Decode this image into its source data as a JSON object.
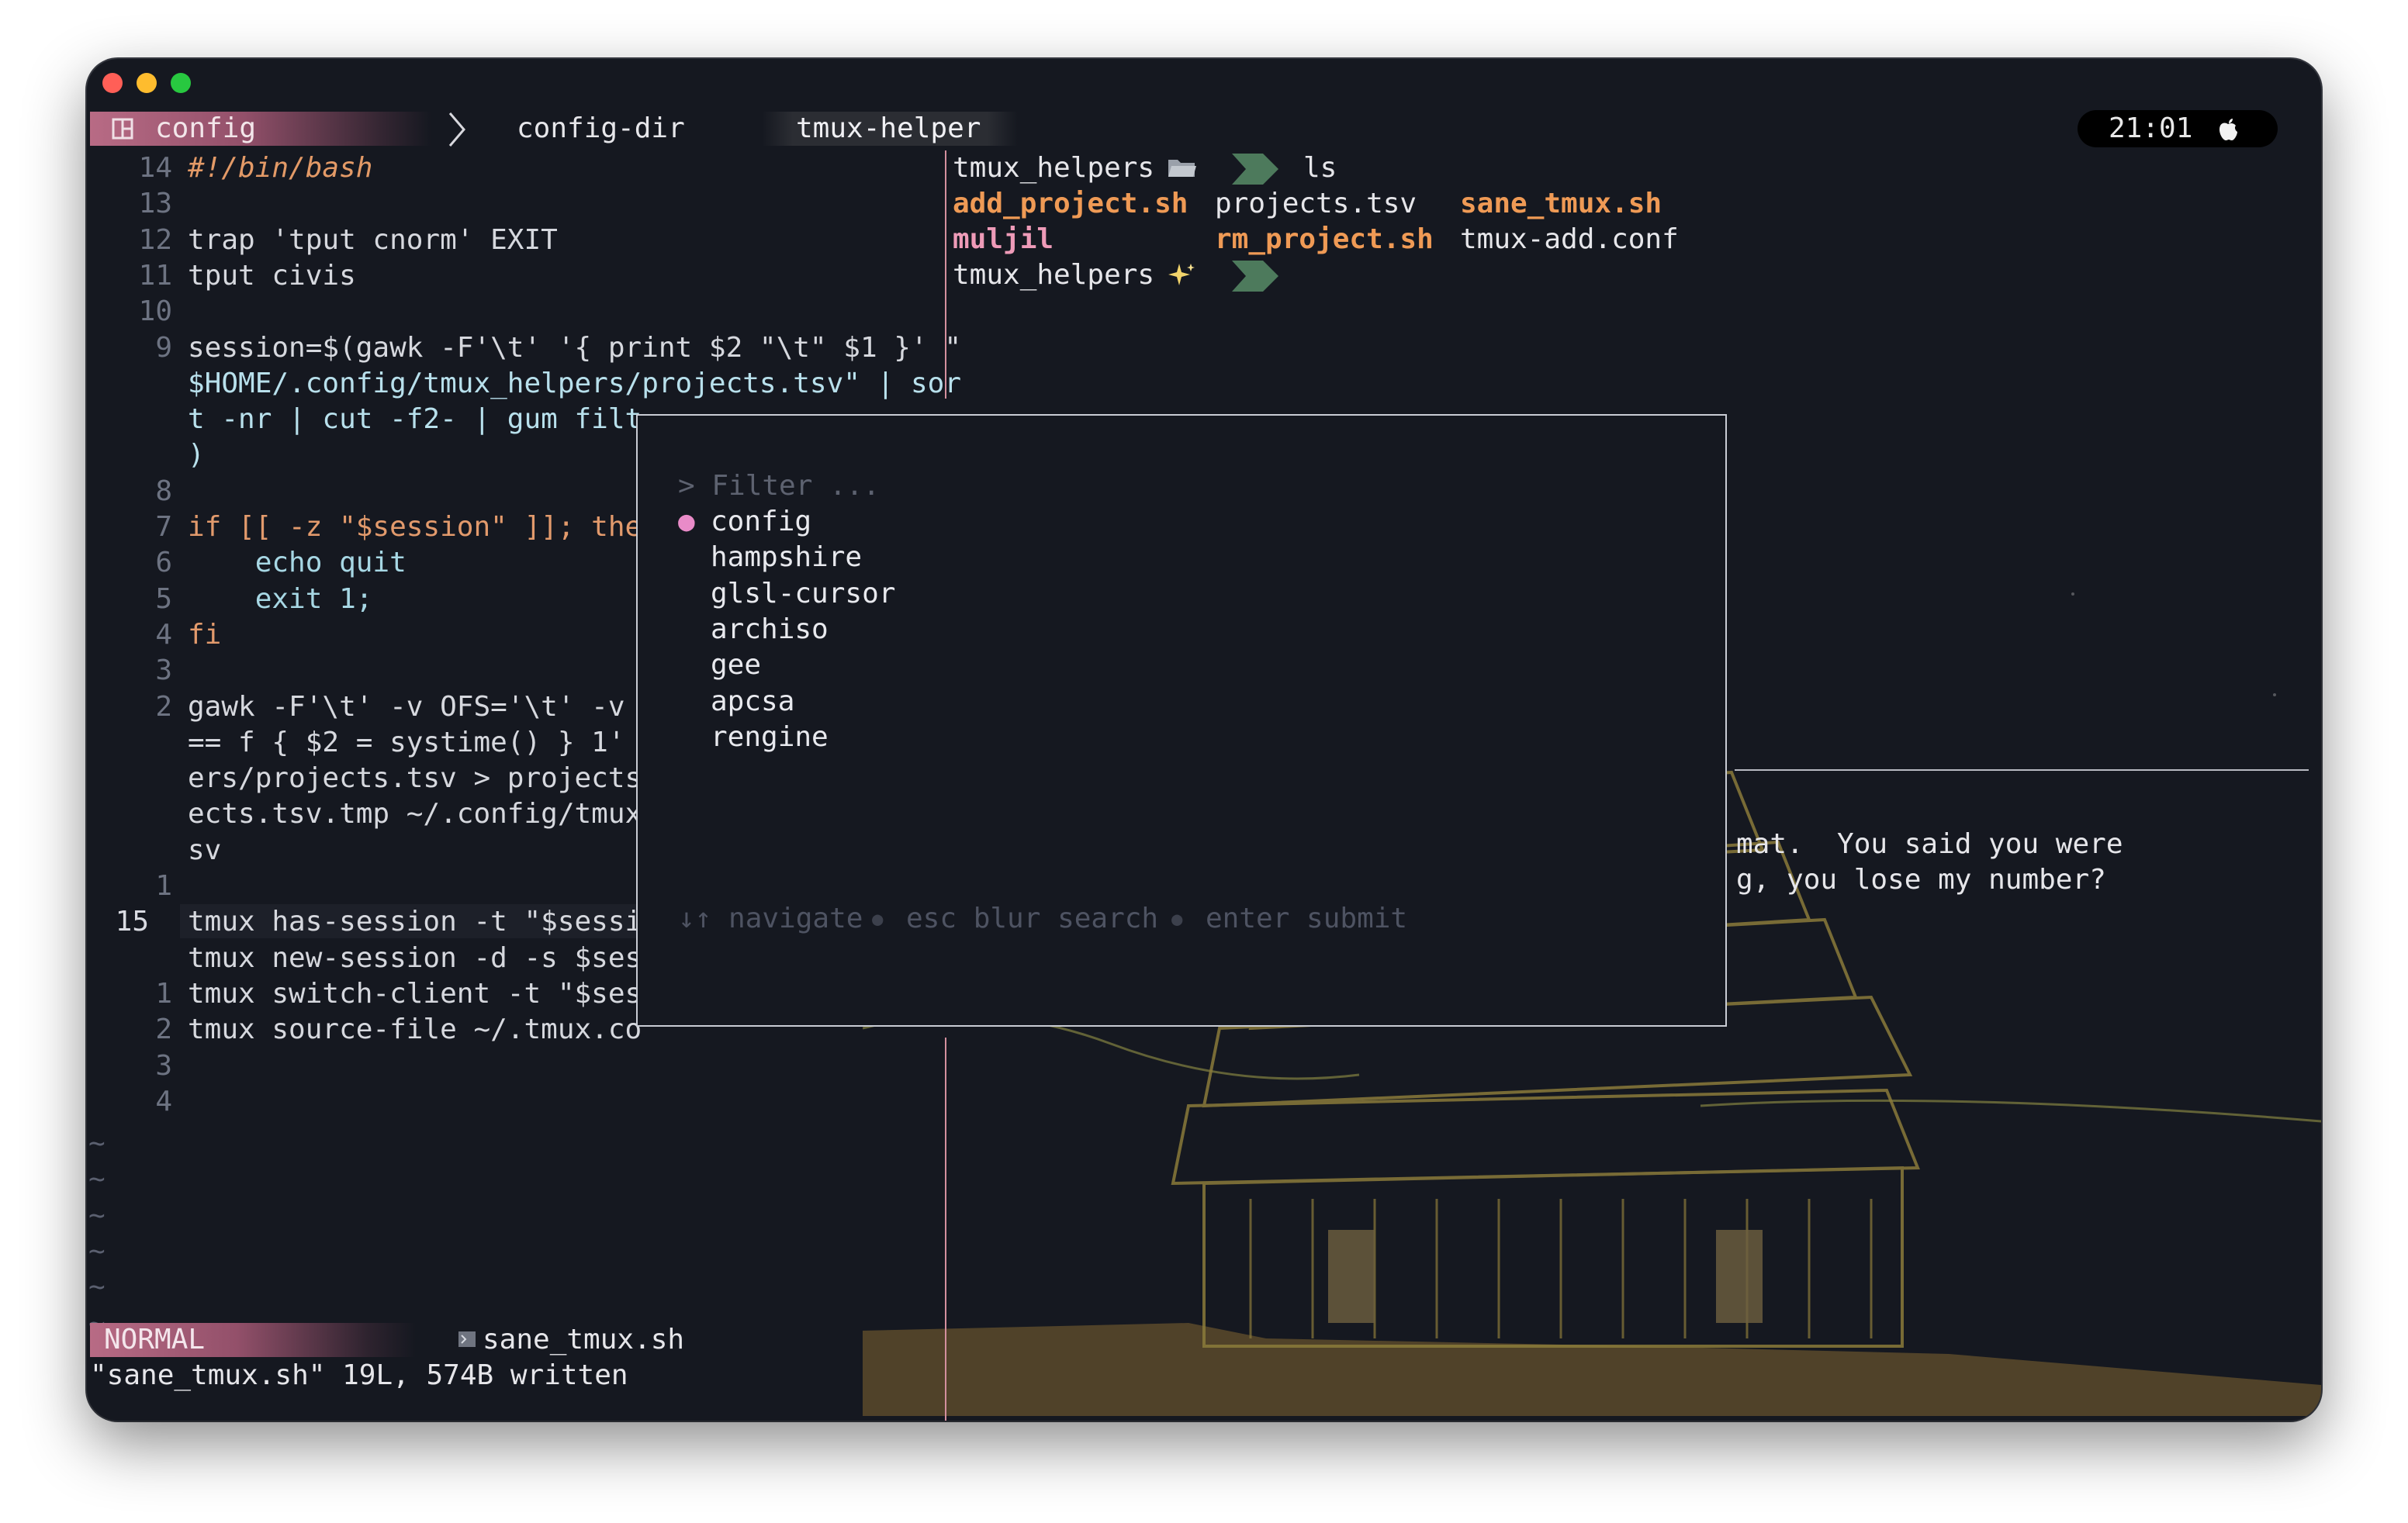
{
  "window": {
    "traffic_lights": {
      "close": "#ff5f57",
      "minimize": "#febc2e",
      "zoom": "#28c840"
    }
  },
  "tmux_bar": {
    "session": "config",
    "windows": [
      "config-dir",
      "tmux-helper"
    ],
    "clock": "21:01",
    "session_icon": "pane-grid-icon",
    "separator_icon": "chevron-right-icon",
    "clock_icon": "apple-logo-icon"
  },
  "editor": {
    "lines": [
      {
        "num": "14",
        "html": "#!/bin/bash",
        "type": "comment"
      },
      {
        "num": "13",
        "text": ""
      },
      {
        "num": "12",
        "text": "trap 'tput cnorm' EXIT"
      },
      {
        "num": "11",
        "text": "tput civis"
      },
      {
        "num": "10",
        "text": ""
      },
      {
        "num": "9",
        "text": "session=$(gawk -F'\\t' '{ print $2 \"\\t\" $1 }' \""
      },
      {
        "num": "",
        "text": "$HOME/.config/tmux_helpers/projects.tsv\" | sor"
      },
      {
        "num": "",
        "text": "t -nr | cut -f2- | gum filt"
      },
      {
        "num": "",
        "text": ")"
      },
      {
        "num": "8",
        "text": ""
      },
      {
        "num": "7",
        "text": "if [[ -z \"$session\" ]]; the"
      },
      {
        "num": "6",
        "text": "    echo quit"
      },
      {
        "num": "5",
        "text": "    exit 1;"
      },
      {
        "num": "4",
        "text": "fi"
      },
      {
        "num": "3",
        "text": ""
      },
      {
        "num": "2",
        "text": "gawk -F'\\t' -v OFS='\\t' -v"
      },
      {
        "num": "",
        "text": "== f { $2 = systime() } 1'"
      },
      {
        "num": "",
        "text": "ers/projects.tsv > projects"
      },
      {
        "num": "",
        "text": "ects.tsv.tmp ~/.config/tmux"
      },
      {
        "num": "",
        "text": "sv"
      },
      {
        "num": "1",
        "text": ""
      },
      {
        "num": "15",
        "text": "tmux has-session -t \"$sessi"
      },
      {
        "num": "",
        "text": "tmux new-session -d -s $ses"
      },
      {
        "num": "1",
        "text": "tmux switch-client -t \"$ses"
      },
      {
        "num": "2",
        "text": "tmux source-file ~/.tmux.co"
      },
      {
        "num": "3",
        "text": ""
      },
      {
        "num": "4",
        "text": ""
      }
    ],
    "tildes": [
      "~",
      "~",
      "~",
      "~",
      "~",
      "~"
    ],
    "mode": "NORMAL",
    "filename": "sane_tmux.sh",
    "message": "\"sane_tmux.sh\" 19L, 574B written"
  },
  "shell": {
    "prompt_dir": "tmux_helpers",
    "prompt_icon1": "folder-icon",
    "command": "ls",
    "files": [
      "add_project.sh",
      "projects.tsv",
      "sane_tmux.sh",
      "muljil",
      "rm_project.sh",
      "tmux-add.conf"
    ],
    "prompt_dir2": "tmux_helpers",
    "prompt_icon2": "sparkles-icon",
    "colors": {
      "exec": "#ef9a55",
      "dir": "#ee9bb8",
      "plain": "#e6e6ea"
    }
  },
  "chat_pane": {
    "line1": "mat.  You said you were",
    "line2": "g, you lose my number?"
  },
  "picker": {
    "prompt": "> Filter ...",
    "selected_marker": "●",
    "items": [
      "config",
      "hampshire",
      "glsl-cursor",
      "archiso",
      "gee",
      "apcsa",
      "rengine"
    ],
    "help_navigate": "↓↑ navigate",
    "help_sep": "●",
    "help_blur": "esc blur search",
    "help_submit": "enter submit"
  }
}
